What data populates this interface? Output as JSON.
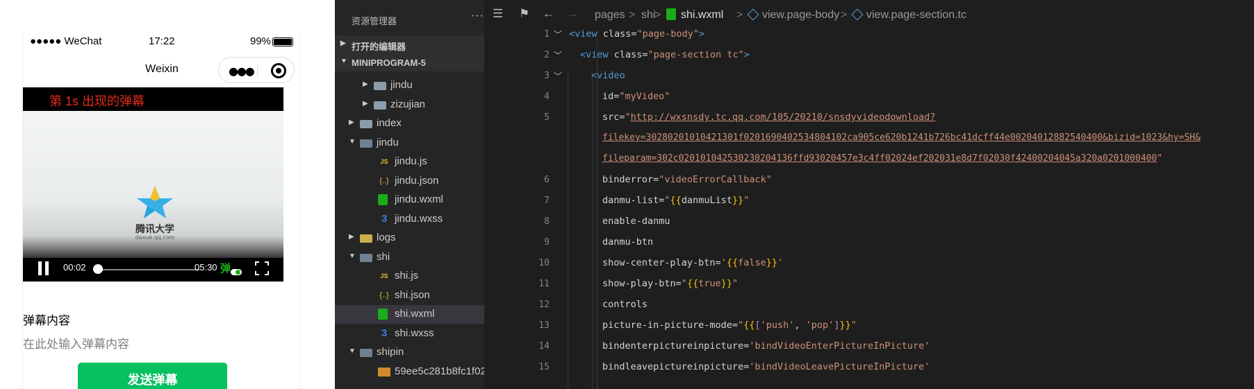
{
  "phone": {
    "status": {
      "carrier": "●●●●● WeChat",
      "time": "17:22",
      "battery": "99%"
    },
    "nav_title": "Weixin",
    "video": {
      "danmu_text": "第 1s 出现的弹幕",
      "logo_text": "腾讯大学",
      "logo_sub": "daxue.qq.com",
      "current_time": "00:02",
      "duration": "05:30",
      "danmu_btn": "弹",
      "progress": 0.006
    },
    "section_label": "弹幕内容",
    "input_placeholder": "在此处输入弹幕内容",
    "send_button": "发送弹幕"
  },
  "explorer": {
    "title": "资源管理器",
    "more": "···",
    "open_editors": "打开的编辑器",
    "project": "MINIPROGRAM-5",
    "items": [
      {
        "name": "jindu",
        "type": "folder"
      },
      {
        "name": "zizujian",
        "type": "folder"
      },
      {
        "name": "index",
        "type": "folder"
      },
      {
        "name": "jindu",
        "type": "folder-open"
      },
      {
        "name": "jindu.js",
        "type": "js"
      },
      {
        "name": "jindu.json",
        "type": "json"
      },
      {
        "name": "jindu.wxml",
        "type": "wxml"
      },
      {
        "name": "jindu.wxss",
        "type": "wxss"
      },
      {
        "name": "logs",
        "type": "folder"
      },
      {
        "name": "shi",
        "type": "folder-open"
      },
      {
        "name": "shi.js",
        "type": "js"
      },
      {
        "name": "shi.json",
        "type": "json"
      },
      {
        "name": "shi.wxml",
        "type": "wxml"
      },
      {
        "name": "shi.wxss",
        "type": "wxss"
      },
      {
        "name": "shipin",
        "type": "folder-open"
      },
      {
        "name": "59ee5c281b8fc1f02...",
        "type": "video"
      }
    ]
  },
  "editor": {
    "breadcrumb": [
      "pages",
      "shi",
      "shi.wxml",
      "view.page-body",
      "view.page-section.tc"
    ],
    "line_numbers": [
      "1",
      "2",
      "3",
      "4",
      "5",
      "6",
      "7",
      "8",
      "9",
      "10",
      "11",
      "12",
      "13",
      "14",
      "15"
    ],
    "code": {
      "l1": {
        "open": "<view",
        "attr": " class=",
        "val": "\"page-body\"",
        "close": ">"
      },
      "l2": {
        "open": "<view",
        "attr": " class=",
        "val": "\"page-section tc\"",
        "close": ">"
      },
      "l3": {
        "open": "<video"
      },
      "l4": {
        "attr": "id=",
        "val": "\"myVideo\""
      },
      "l5": {
        "attr": "src=",
        "q": "\"",
        "url1": "http://wxsnsdy.tc.qq.com/105/20210/snsdyvideodownload?",
        "url2": "filekey=30280201010421301f0201690402534804102ca905ce620b1241b726bc41dcff44e00204012882540400&bizid=1023&hy=SH&",
        "url3": "fileparam=302c020101042530230204136ffd93020457e3c4ff02024ef202031e8d7f02030f42400204045a320a0201000400"
      },
      "l6": {
        "attr": "binderror=",
        "val": "\"videoErrorCallback\""
      },
      "l7": {
        "attr": "danmu-list=",
        "q": "\"",
        "b1": "{{",
        "v": "danmuList",
        "b2": "}}"
      },
      "l8": {
        "attr": "enable-danmu"
      },
      "l9": {
        "attr": "danmu-btn"
      },
      "l10": {
        "attr": "show-center-play-btn=",
        "q": "'",
        "b1": "{{",
        "v": "false",
        "b2": "}}"
      },
      "l11": {
        "attr": "show-play-btn=",
        "q": "\"",
        "b1": "{{",
        "v": "true",
        "b2": "}}"
      },
      "l12": {
        "attr": "controls"
      },
      "l13": {
        "attr": "picture-in-picture-mode=",
        "q": "\"",
        "b1": "{{",
        "k1": "[",
        "s1": "'push'",
        "c": ", ",
        "s2": "'pop'",
        "k2": "]",
        "b2": "}}"
      },
      "l14": {
        "attr": "bindenterpictureinpicture=",
        "val": "'bindVideoEnterPictureInPicture'"
      },
      "l15": {
        "attr": "bindleavepictureinpicture=",
        "val": "'bindVideoLeavePictureInPicture'"
      }
    }
  },
  "colors": {
    "accent": "#07c160",
    "danmu": "#e22a1c",
    "editor_bg": "#1e1e1e",
    "sidebar_bg": "#252526"
  }
}
